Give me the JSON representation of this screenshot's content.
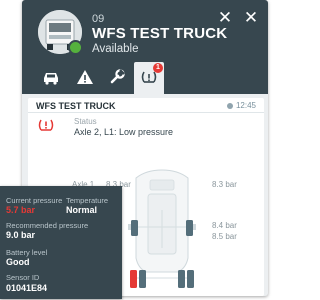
{
  "vehicle": {
    "id": "09",
    "name": "WFS TEST TRUCK",
    "status": "Available",
    "status_color": "#55b13d"
  },
  "header": {
    "buttons": [
      {
        "icon": "close-x-icon",
        "glyph": "✕"
      },
      {
        "icon": "close-icon",
        "glyph": "✕"
      }
    ],
    "background": "#37474f"
  },
  "tabs": [
    {
      "icon": "truck-icon"
    },
    {
      "icon": "warning-icon"
    },
    {
      "icon": "wrench-icon"
    },
    {
      "icon": "tire-alert-icon",
      "badge": "1",
      "active": true
    }
  ],
  "card": {
    "title": "WFS TEST TRUCK",
    "time": "12:45",
    "status_label": "Status",
    "status_text": "Axle 2, L1: Low pressure"
  },
  "axles": [
    {
      "label": "Axle 1",
      "left": "",
      "right": "8.3 bar",
      "right_partial": "8.3 bar"
    },
    {
      "label": "",
      "right_1": "8.4 bar",
      "right_2": "8.5 bar"
    }
  ],
  "tooltip": {
    "current_pressure_label": "Current pressure",
    "current_pressure": "5.7 bar",
    "temperature_label": "Temperature",
    "temperature": "Normal",
    "recommended_label": "Recommended pressure",
    "recommended": "9.0 bar",
    "battery_label": "Battery level",
    "battery": "Good",
    "sensor_label": "Sensor ID",
    "sensor": "01041E84"
  },
  "colors": {
    "accent": "#37474f",
    "alert": "#e53935",
    "ok": "#55b13d"
  }
}
